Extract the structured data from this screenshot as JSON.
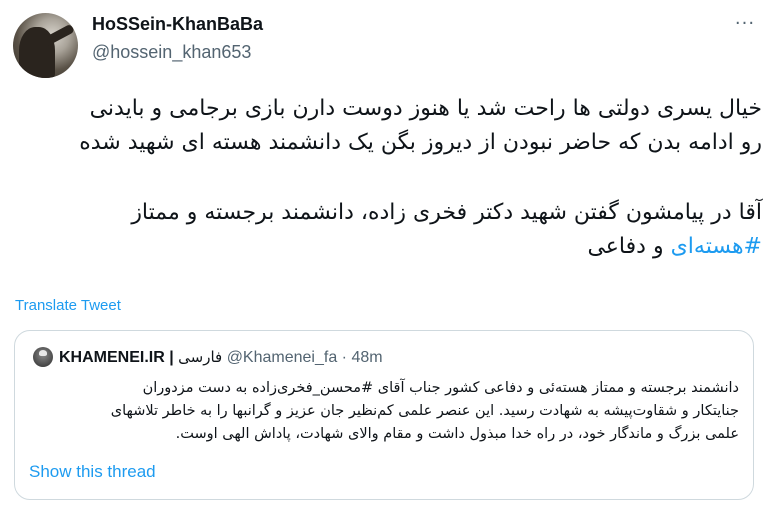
{
  "tweet": {
    "display_name": "HoSSein-KhanBaBa",
    "handle": "@hossein_khan653",
    "more_icon": "more-dots-icon",
    "more_glyph": "···",
    "line1": "خیال یسری دولتی ها راحت شد یا هنوز دوست دارن بازی برجامی و بایدنی",
    "line2": "رو ادامه بدن که حاضر نبودن از دیروز بگن یک دانشمند هسته ای شهید شده",
    "line3": "آقا در پیامشون گفتن شهید دکتر فخری زاده، دانشمند برجسته و ممتاز",
    "hashtag": "#هسته‌ای",
    "line4_rest": " و دفاعی",
    "translate_label": "Translate Tweet"
  },
  "quoted": {
    "display_name": "KHAMENEI.IR",
    "separator": "|",
    "name_fa": "فارسی",
    "handle": "@Khamenei_fa",
    "dot": "·",
    "time": "48m",
    "line1": "دانشمند برجسته و ممتاز هسته‌ئی و دفاعی کشور جناب آقای #محسن_فخری‌زاده به دست مزدوران",
    "line2": "جنایتکار و شقاوت‌پیشه به شهادت رسید. این عنصر علمی کم‌نظیر جان عزیز و گرانبها را به خاطر تلاشهای",
    "line3": "علمی بزرگ و ماندگار خود، در راه خدا مبذول داشت و مقام والای شهادت، پاداش الهی اوست.",
    "show_thread_label": "Show this thread"
  },
  "colors": {
    "text": "#0f1419",
    "secondary": "#536471",
    "link": "#1d9bf0",
    "border": "#cfd9de"
  }
}
